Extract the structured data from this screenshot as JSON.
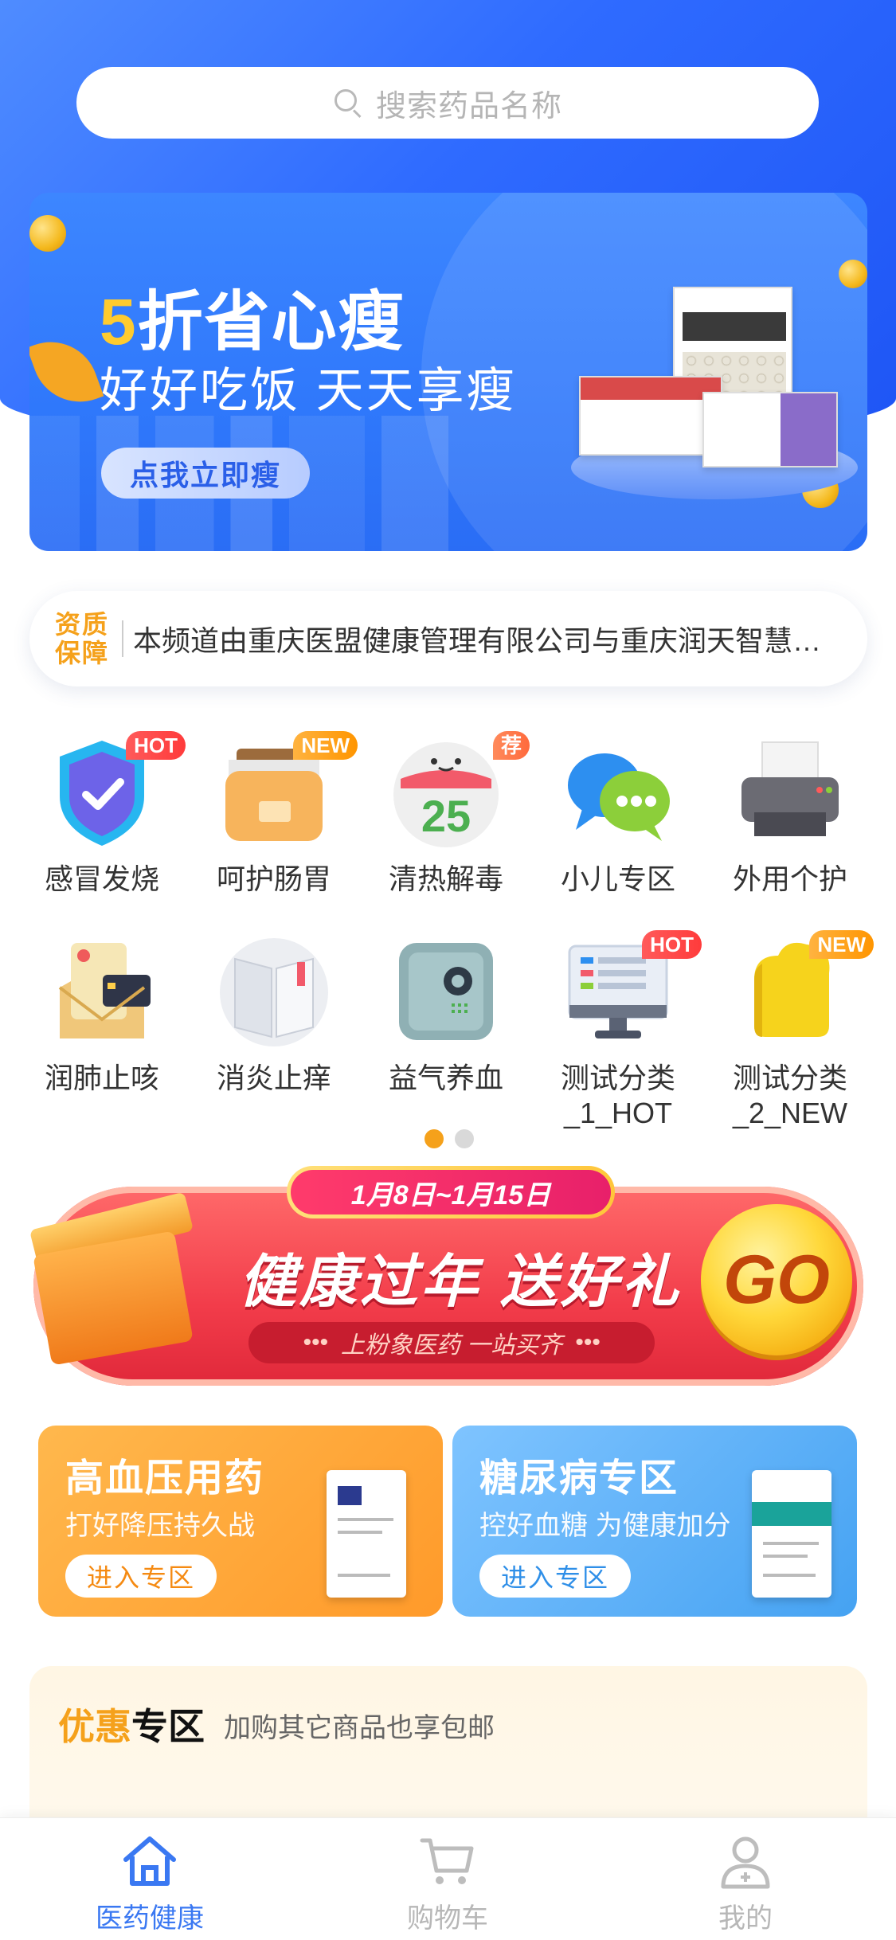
{
  "search": {
    "placeholder": "搜索药品名称"
  },
  "banner": {
    "title_num": "5",
    "title_rest": "折省心瘦",
    "subtitle": "好好吃饭 天天享瘦",
    "button": "点我立即瘦"
  },
  "notice": {
    "tag_line1": "资质",
    "tag_line2": "保障",
    "text": "本频道由重庆医盟健康管理有限公司与重庆润天智慧…"
  },
  "categories": [
    {
      "label": "感冒发烧",
      "badge": "HOT",
      "icon": "shield-icon"
    },
    {
      "label": "呵护肠胃",
      "badge": "NEW",
      "icon": "folder-icon"
    },
    {
      "label": "清热解毒",
      "badge": "荐",
      "icon": "calendar-icon"
    },
    {
      "label": "小儿专区",
      "badge": "",
      "icon": "chat-bubbles-icon"
    },
    {
      "label": "外用个护",
      "badge": "",
      "icon": "printer-icon"
    },
    {
      "label": "润肺止咳",
      "badge": "",
      "icon": "mail-card-icon"
    },
    {
      "label": "消炎止痒",
      "badge": "",
      "icon": "book-icon"
    },
    {
      "label": "益气养血",
      "badge": "",
      "icon": "safe-icon"
    },
    {
      "label": "测试分类_1_HOT",
      "badge": "HOT",
      "icon": "monitor-icon"
    },
    {
      "label": "测试分类_2_NEW",
      "badge": "NEW",
      "icon": "cloud-icon"
    }
  ],
  "pager": {
    "pages": 2,
    "active": 0
  },
  "promo": {
    "date": "1月8日~1月15日",
    "title": "健康过年 送好礼",
    "subtitle": "上粉象医药 一站买齐",
    "go": "GO"
  },
  "cards": [
    {
      "title": "高血压用药",
      "subtitle": "打好降压持久战",
      "button": "进入专区"
    },
    {
      "title": "糖尿病专区",
      "subtitle": "控好血糖 为健康加分",
      "button": "进入专区"
    }
  ],
  "deal": {
    "title_a": "优惠",
    "title_b": "专区",
    "subtitle": "加购其它商品也享包邮"
  },
  "tabs": [
    {
      "label": "医药健康",
      "active": true,
      "icon": "home-icon"
    },
    {
      "label": "购物车",
      "active": false,
      "icon": "cart-icon"
    },
    {
      "label": "我的",
      "active": false,
      "icon": "user-icon"
    }
  ],
  "colors": {
    "primary": "#2f6bff",
    "accent": "#f5a11b",
    "hot": "#ff3b3b",
    "promo": "#f23c4a"
  }
}
